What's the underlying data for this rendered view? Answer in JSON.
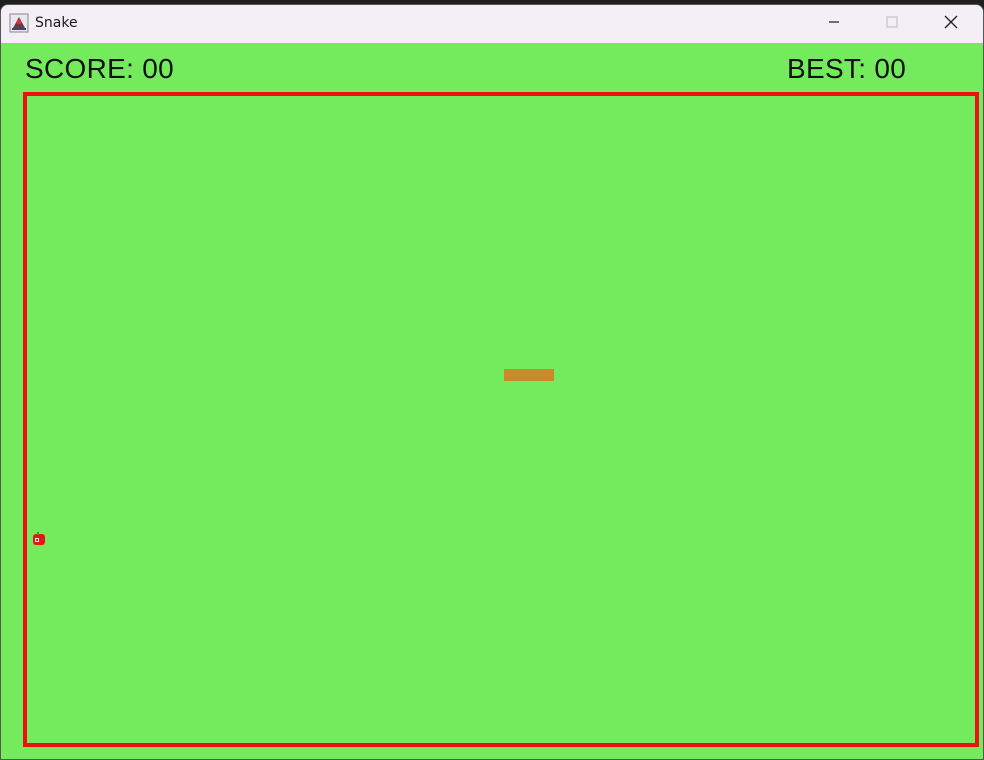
{
  "window": {
    "title": "Snake",
    "icon": "java-app-icon",
    "controls": [
      "minimize-icon",
      "maximize-icon",
      "close-icon"
    ]
  },
  "hud": {
    "score_text": "SCORE: 00",
    "best_text": "BEST: 00",
    "score": 0,
    "best": 0
  },
  "game": {
    "background_color": "#73eb5c",
    "border_color": "#ee1111",
    "snake_color": "#c98a2c",
    "food": "apple-icon"
  }
}
